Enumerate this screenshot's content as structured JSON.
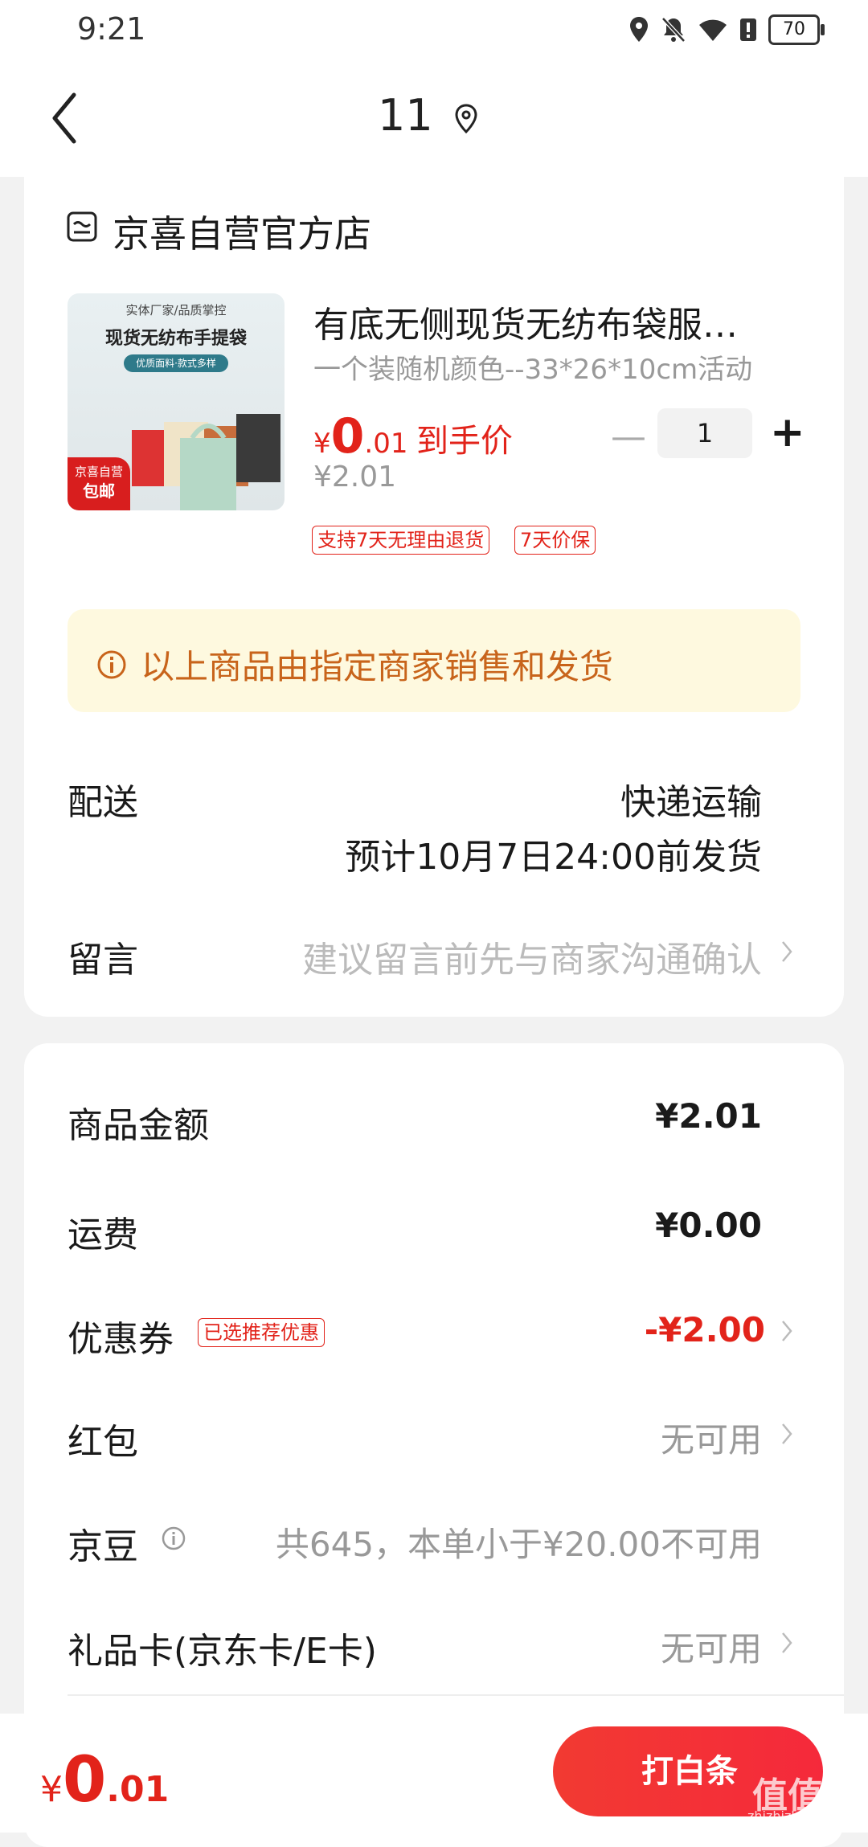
{
  "status_bar": {
    "time": "9:21",
    "battery": "70"
  },
  "header": {
    "title": "11"
  },
  "store": {
    "name": "京喜自营官方店"
  },
  "product": {
    "image_text_top": "实体厂家/品质掌控",
    "image_text_main": "现货无纺布手提袋",
    "image_text_pill": "优质面料·款式多样",
    "image_badge_line1": "京喜自营",
    "image_badge_line2": "包邮",
    "title": "有底无侧现货无纺布袋服…",
    "spec": "一个装随机颜色--33*26*10cm活动",
    "price_currency": "¥",
    "price_int": "0",
    "price_dec": ".01",
    "price_label": "到手价",
    "original_price": "¥2.01",
    "quantity": "1",
    "tags": [
      "支持7天无理由退货",
      "7天价保"
    ]
  },
  "notice": {
    "text": "以上商品由指定商家销售和发货"
  },
  "shipping": {
    "label": "配送",
    "method": "快递运输",
    "estimate": "预计10月7日24:00前发货"
  },
  "message": {
    "label": "留言",
    "placeholder": "建议留言前先与商家沟通确认"
  },
  "summary": {
    "goods_label": "商品金额",
    "goods_value": "¥2.01",
    "freight_label": "运费",
    "freight_value": "¥0.00",
    "coupon_label": "优惠券",
    "coupon_tag": "已选推荐优惠",
    "coupon_value": "-¥2.00",
    "hongbao_label": "红包",
    "hongbao_value": "无可用",
    "jingdou_label": "京豆",
    "jingdou_value": "共645，本单小于¥20.00不可用",
    "giftcard_label": "礼品卡(京东卡/E卡)",
    "giftcard_value": "无可用"
  },
  "footer": {
    "currency": "¥",
    "total_int": "0",
    "total_dec": ".01",
    "pay_button": "打白条"
  },
  "watermark": {
    "main": "值值值",
    "sub": "zhizhizhi.com"
  },
  "colors": {
    "accent": "#e2231a",
    "notice_bg": "#fef9df",
    "notice_text": "#c8641b"
  }
}
